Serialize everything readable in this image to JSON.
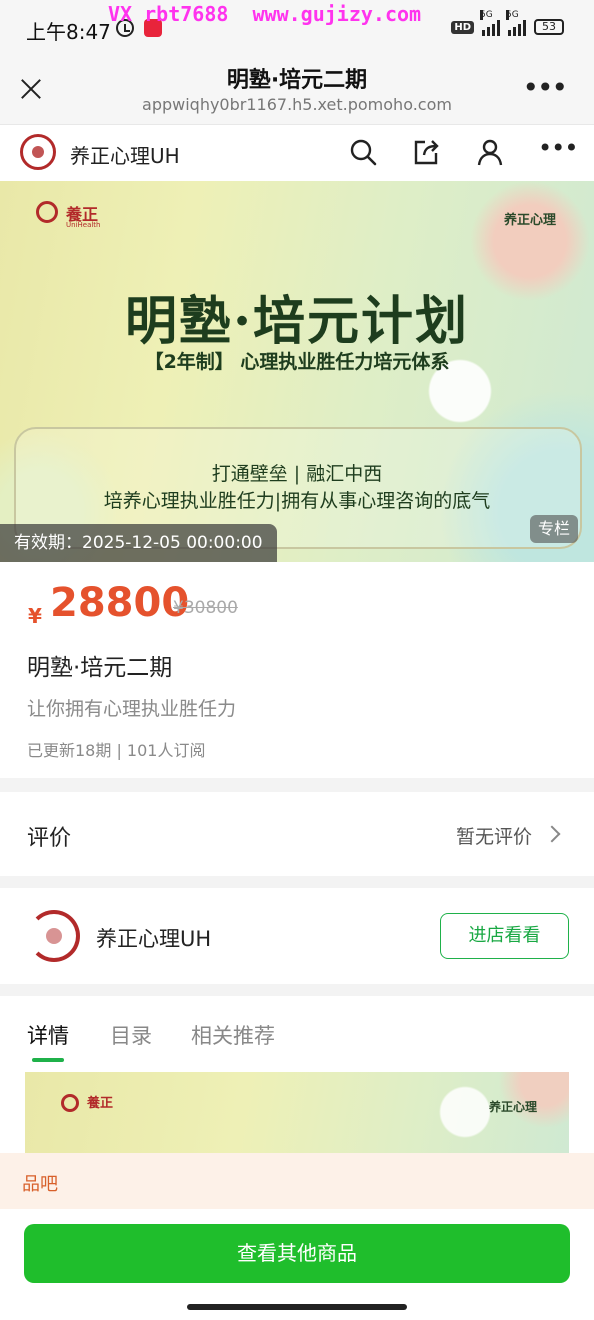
{
  "status_bar": {
    "time": "上午8:47",
    "watermark": "VX rbt7688  www.gujizy.com",
    "hd_label": "HD",
    "network_1": "5G",
    "network_2": "5G",
    "battery": "53"
  },
  "title_bar": {
    "title": "明塾·培元二期",
    "url": "appwiqhy0br1167.h5.xet.pomoho.com"
  },
  "shop_header": {
    "name": "养正心理UH"
  },
  "banner": {
    "logo_text": "養正",
    "logo_sub": "UniHealth",
    "brand": "养正心理",
    "title": "明塾·培元计划",
    "subtitle": "【2年制】 心理执业胜任力培元体系",
    "line1": "打通壁垒 | 融汇中西",
    "line2": "培养心理执业胜任力|拥有从事心理咨询的底气",
    "validity": "有效期：2025-12-05 00:00:00",
    "tag": "专栏"
  },
  "product": {
    "price_symbol": "¥",
    "price": "28800",
    "original_price": "¥30800",
    "name": "明塾·培元二期",
    "description": "让你拥有心理执业胜任力",
    "meta": "已更新18期 | 101人订阅"
  },
  "review": {
    "label": "评价",
    "status": "暂无评价"
  },
  "shop_card": {
    "name": "养正心理UH",
    "enter_button": "进店看看"
  },
  "tabs": [
    {
      "label": "详情"
    },
    {
      "label": "目录"
    },
    {
      "label": "相关推荐"
    }
  ],
  "detail_image": {
    "logo_text": "養正",
    "brand": "养正心理"
  },
  "toast": {
    "text": "品吧"
  },
  "bottom": {
    "button_label": "查看其他商品"
  },
  "colors": {
    "price": "#e5522d",
    "accent_green": "#1fbe2c",
    "brand_red": "#b22a2a"
  }
}
